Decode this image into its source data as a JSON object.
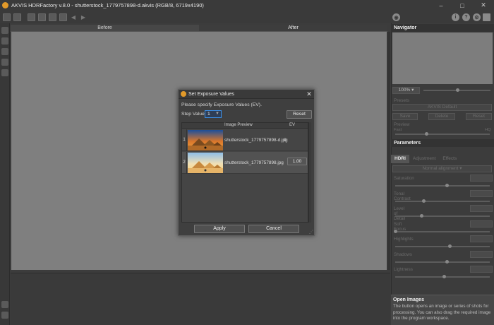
{
  "window": {
    "title": "AKVIS HDRFactory v.8.0 - shutterstock_1779757898-d.akvis (RGB/8, 6719x4190)",
    "minimize_glyph": "–",
    "maximize_glyph": "□",
    "close_glyph": "✕"
  },
  "top_right_icons": {
    "info": "i",
    "help": "?",
    "settings": "⚙",
    "share": "◉"
  },
  "view_tabs": {
    "before": "Before",
    "after": "After"
  },
  "right_panel": {
    "navigator_title": "Navigator",
    "zoom_value": "100%",
    "presets_title": "Presets",
    "preset_name": "AKVIS Default",
    "save_label": "Save",
    "delete_label": "Delete",
    "reset_label": "Reset",
    "preview_label": "Preview",
    "preview_fast": "Fast",
    "preview_hq": "HQ",
    "parameters_title": "Parameters",
    "tabs": [
      "HDRI",
      "Adjustment",
      "Effects"
    ],
    "alignment_mode": "Normal alignment",
    "params": [
      {
        "label": "Saturation",
        "value": "",
        "level": 0.55
      },
      {
        "label": "Tonal Contrast",
        "value": "",
        "level": 0.3
      },
      {
        "label": "Level of Detail",
        "value": "",
        "level": 0.28
      },
      {
        "label": "Soft Focus",
        "value": "",
        "level": 0.0
      },
      {
        "label": "Highlights",
        "value": "",
        "level": 0.58
      },
      {
        "label": "Shadows",
        "value": "",
        "level": 0.55
      },
      {
        "label": "Lightness",
        "value": "",
        "level": 0.52
      }
    ],
    "help_title": "Open Images",
    "help_text": "The button opens an image or series of shots for processing. You can also drag the required image into the program workspace."
  },
  "dialog": {
    "title": "Set Exposure Values",
    "close_glyph": "✕",
    "description": "Please specify Exposure Values (EV).",
    "step_label": "Step Value",
    "step_value": "1",
    "reset_label": "Reset",
    "columns": [
      "Image Preview",
      "EV"
    ],
    "rows": [
      {
        "index": "1",
        "filename": "shutterstock_1779757898-d.jpg",
        "ev": "0"
      },
      {
        "index": "2",
        "filename": "shutterstock_1779757898.jpg",
        "ev": "1,00"
      }
    ],
    "apply_label": "Apply",
    "cancel_label": "Cancel"
  },
  "colors": {
    "accent": "#3a8ee6",
    "app_icon": "#e29a2a",
    "canvas": "#7f7f7f"
  }
}
